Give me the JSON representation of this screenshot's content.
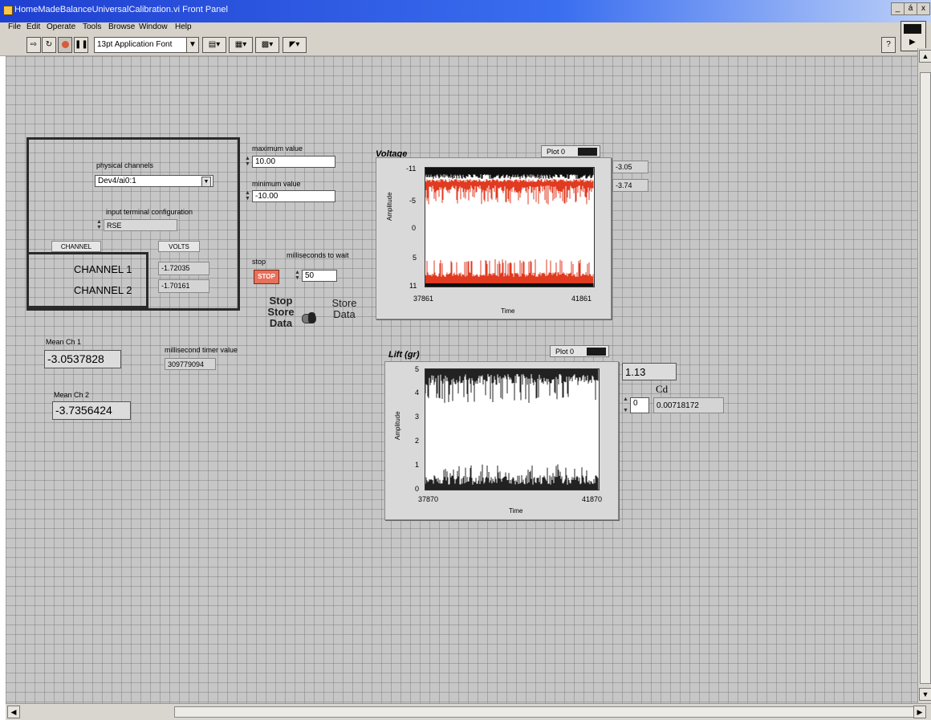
{
  "window": {
    "title": "HomeMadeBalanceUniversalCalibration.vi Front Panel",
    "controls": [
      "_",
      "á",
      "x"
    ]
  },
  "menu": [
    "File",
    "Edit",
    "Operate",
    "Tools",
    "Browse",
    "Window",
    "Help"
  ],
  "toolbar": {
    "font_label": "13pt Application Font"
  },
  "daq": {
    "physical_channels_label": "physical channels",
    "physical_channels_value": "Dev4/ai0:1",
    "terminal_config_label": "input terminal configuration",
    "terminal_config_value": "RSE",
    "channel_header": "CHANNEL",
    "volts_header": "VOLTS",
    "channels": [
      {
        "name": "CHANNEL 1",
        "volts": "-1.72035"
      },
      {
        "name": "CHANNEL 2",
        "volts": "-1.70161"
      }
    ]
  },
  "limits": {
    "max_label": "maximum value",
    "max_value": "10.00",
    "min_label": "minimum value",
    "min_value": "-10.00"
  },
  "controls": {
    "stop_label": "stop",
    "stop_button": "STOP",
    "wait_label": "milliseconds to wait",
    "wait_value": "50",
    "switch_left": "Stop Store Data",
    "switch_right": "Store Data",
    "timer_label": "millisecond timer value",
    "timer_value": "309779094"
  },
  "means": {
    "ch1_label": "Mean Ch 1",
    "ch1_value": "-3.0537828",
    "ch2_label": "Mean Ch 2",
    "ch2_value": "-3.7356424"
  },
  "voltage_graph": {
    "title": "Voltage",
    "legend": "Plot 0",
    "ylabel": "Amplitude",
    "xlabel": "Time",
    "y_ticks": [
      "-11",
      "-5",
      "0",
      "5",
      "11"
    ],
    "x_start": "37861",
    "x_end": "41861",
    "readout_1": "-3.05",
    "readout_2": "-3.74",
    "colors": {
      "series_a": "#111111",
      "series_b": "#e03a20"
    }
  },
  "lift_graph": {
    "title": "Lift (gr)",
    "legend": "Plot 0",
    "ylabel": "Amplitude",
    "xlabel": "Time",
    "y_ticks": [
      "5",
      "4",
      "3",
      "2",
      "1",
      "0"
    ],
    "x_start": "37870",
    "x_end": "41870",
    "readout": "1.13",
    "cd_label": "Cd",
    "cd_index": "0",
    "cd_value": "0.00718172",
    "colors": {
      "series": "#222222"
    }
  }
}
